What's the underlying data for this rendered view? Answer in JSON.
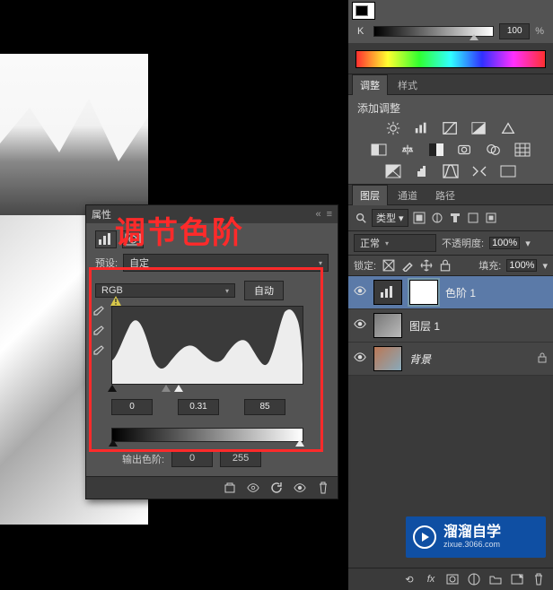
{
  "color_panel": {
    "channel_label": "K",
    "value": "100",
    "percent": "%"
  },
  "adjust_tabs": {
    "t1": "调整",
    "t2": "样式"
  },
  "add_adjust_label": "添加调整",
  "adj_icons": {
    "r1": [
      "brightness-icon",
      "levels-icon",
      "curves-icon",
      "exposure-icon",
      "vibrance-icon"
    ],
    "r2": [
      "hue-icon",
      "colorbalance-icon",
      "bw-icon",
      "photofilter-icon",
      "channelmixer-icon",
      "colorlookup-icon"
    ],
    "r3": [
      "invert-icon",
      "posterize-icon",
      "threshold-icon",
      "selective-icon",
      "gradientmap-icon"
    ]
  },
  "layers_tabs": {
    "t1": "图层",
    "t2": "通道",
    "t3": "路径"
  },
  "layers_toolbar": {
    "filter_label": "类型"
  },
  "blend_row": {
    "mode": "正常",
    "opacity_label": "不透明度:",
    "opacity_val": "100%"
  },
  "lock_row": {
    "lock_label": "锁定:",
    "fill_label": "填充:",
    "fill_val": "100%"
  },
  "layers": [
    {
      "name": "色阶 1",
      "kind": "adjust"
    },
    {
      "name": "图层 1",
      "kind": "raster"
    },
    {
      "name": "背景",
      "kind": "bg"
    }
  ],
  "overlay_text": "调节色阶",
  "props_panel": {
    "title": "属性",
    "preset_label": "预设:",
    "preset_value": "自定",
    "channel_value": "RGB",
    "auto_btn": "自动",
    "input_black": "0",
    "input_gamma": "0.31",
    "input_white": "85",
    "output_label": "输出色阶:",
    "output_black": "0",
    "output_white": "255"
  },
  "watermark": {
    "cn": "溜溜自学",
    "en": "zixue.3066.com"
  }
}
